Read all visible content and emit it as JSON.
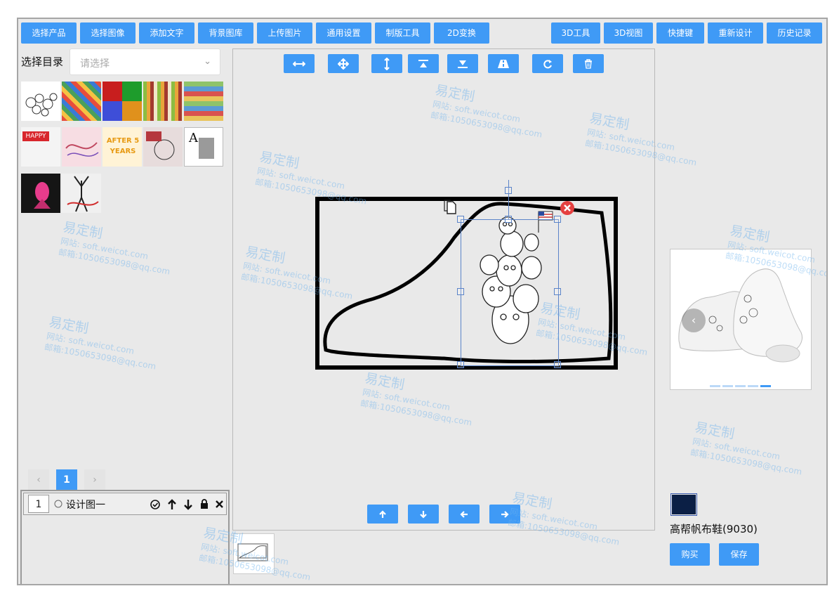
{
  "toolbar": {
    "left": [
      "选择产品",
      "选择图像",
      "添加文字",
      "背景图库",
      "上传图片",
      "通用设置",
      "制版工具",
      "2D变换"
    ],
    "right": [
      "3D工具",
      "3D视图",
      "快捷键",
      "重新设计",
      "历史记录"
    ]
  },
  "sidebar": {
    "catalog_label": "选择目录",
    "catalog_placeholder": "请选择",
    "thumbnails": [
      {
        "name": "doodle-art-thumb",
        "text": ""
      },
      {
        "name": "pattern-tiles-thumb",
        "text": ""
      },
      {
        "name": "color-blocks-thumb",
        "text": ""
      },
      {
        "name": "pattern-stripes-thumb",
        "text": ""
      },
      {
        "name": "pattern-grid-thumb",
        "text": ""
      },
      {
        "name": "happy-card-thumb",
        "text": "HAPPY"
      },
      {
        "name": "abstract-pink-thumb",
        "text": ""
      },
      {
        "name": "after-years-thumb",
        "text": "AFTER 5 YEARS"
      },
      {
        "name": "photo-collage-thumb",
        "text": ""
      },
      {
        "name": "letter-a-thumb",
        "text": "A"
      },
      {
        "name": "neon-girl-thumb",
        "text": ""
      },
      {
        "name": "dancer-thumb",
        "text": ""
      }
    ],
    "pagination": {
      "current": "1",
      "prev": "‹",
      "next": "›"
    }
  },
  "layers": [
    {
      "index": "1",
      "name": "设计图一"
    }
  ],
  "canvas_tools": [
    "flip-horizontal",
    "move",
    "flip-vertical",
    "align-top",
    "align-bottom",
    "road",
    "redo",
    "delete"
  ],
  "nav_arrows": [
    "arrow-up",
    "arrow-down",
    "arrow-left",
    "arrow-right"
  ],
  "product": {
    "name": "高帮帆布鞋(9030)",
    "swatch_color": "#0b1f45",
    "buy_label": "购买",
    "save_label": "保存",
    "carousel_dots": 5,
    "carousel_active": 5
  },
  "colors": {
    "accent": "#3f9af6",
    "panel": "#e9e9e9"
  },
  "watermark": {
    "title": "易定制",
    "site": "网站: soft.weicot.com",
    "mail": "邮箱:1050653098@qq.com"
  }
}
